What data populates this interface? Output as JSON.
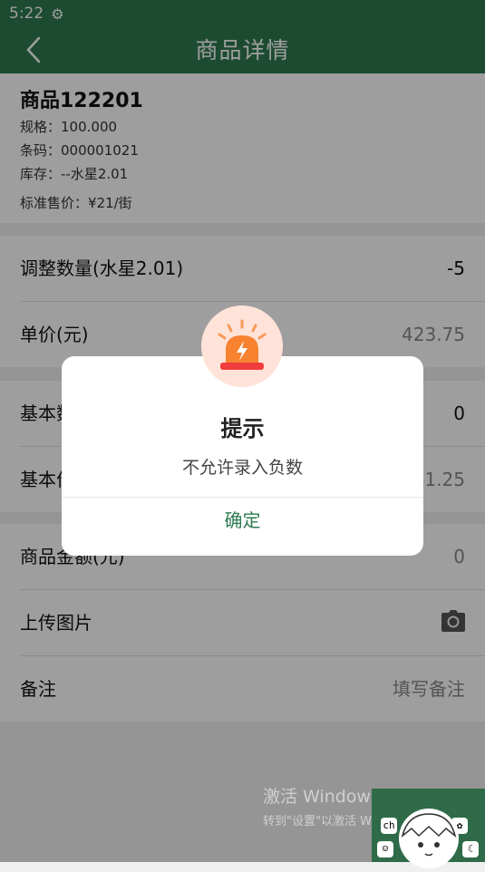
{
  "status": {
    "time": "5:22"
  },
  "nav": {
    "title": "商品详情"
  },
  "product": {
    "name": "商品122201",
    "spec": "规格：100.000",
    "barcode": "条码：000001021",
    "stock": "库存：--水星2.01",
    "price": "标准售价：¥21/街"
  },
  "rows1": [
    {
      "label": "调整数量(水星2.01)",
      "value": "-5"
    },
    {
      "label": "单价(元)",
      "value": "423.75"
    }
  ],
  "rows2": [
    {
      "label": "基本数",
      "value": "0"
    },
    {
      "label": "基本价",
      "value": "41.25"
    }
  ],
  "rows3": [
    {
      "label": "商品金额(元)",
      "value": "0"
    },
    {
      "label": "上传图片"
    },
    {
      "label": "备注",
      "placeholder": "填写备注"
    }
  ],
  "dialog": {
    "title": "提示",
    "message": "不允许录入负数",
    "confirm": "确定"
  },
  "watermark": {
    "line1": "激活 Windows",
    "line2": "转到\"设置\"以激活 Windows。"
  },
  "mascot": {
    "key_label": "ch"
  },
  "colors": {
    "primary": "#2f7a52",
    "overlay": "rgba(0,0,0,0.38)",
    "alarm": "#f4513b"
  }
}
